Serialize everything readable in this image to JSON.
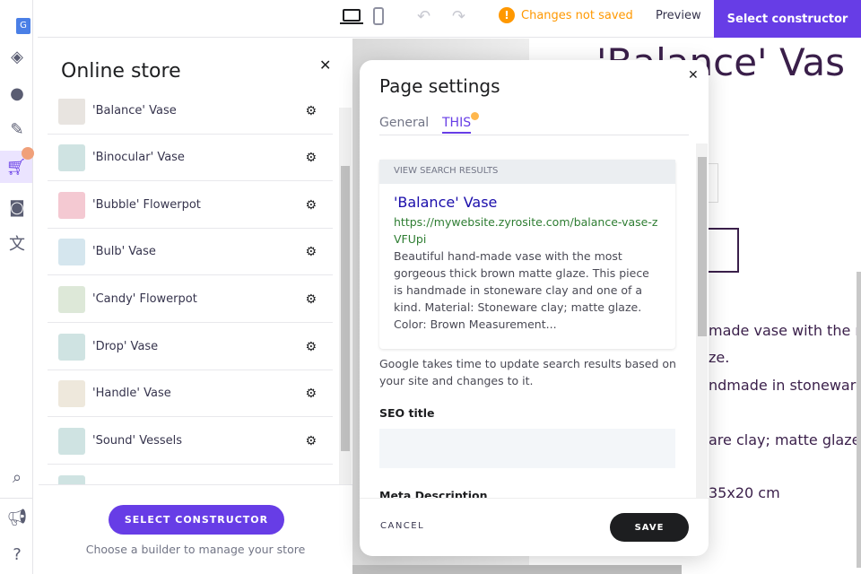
{
  "topbar": {
    "changes_status": "Changes not saved",
    "preview": "Preview",
    "select_constructor": "Select constructor"
  },
  "panel": {
    "title": "Online store",
    "products": [
      "'Balance' Vase",
      "'Binocular' Vase",
      "'Bubble' Flowerpot",
      "'Bulb' Vase",
      "'Candy' Flowerpot",
      "'Drop' Vase",
      "'Handle' Vase",
      "'Sound' Vessels"
    ],
    "cta": "SELECT CONSTRUCTOR",
    "hint": "Choose a builder to manage your store"
  },
  "canvas": {
    "heading": "'Balance' Vas",
    "fragments": [
      "made vase with the m",
      "ze.",
      "ndmade in stoneware",
      "are clay; matte glaze.",
      "35x20 cm"
    ]
  },
  "modal": {
    "title": "Page settings",
    "tabs": [
      "General",
      "THIS"
    ],
    "preview_header": "VIEW SEARCH RESULTS",
    "result_title": "'Balance' Vase",
    "result_url": "https://mywebsite.zyrosite.com/balance-vase-zVFUpi",
    "result_desc": "Beautiful hand-made vase with the most gorgeous thick brown matte glaze. This piece is handmade in stoneware clay and one of a kind. Material: Stoneware clay; matte glaze. Color: Brown Measurement...",
    "note": "Google takes time to update search results based on your site and changes to it.",
    "seo_title_label": "SEO title",
    "seo_title_value": "",
    "meta_label": "Meta Description",
    "cancel": "CANCEL",
    "save": "SAVE"
  },
  "colors": {
    "accent": "#673de6",
    "warning": "#ff9800",
    "link": "#1a0dab",
    "url": "#2e7d32"
  }
}
